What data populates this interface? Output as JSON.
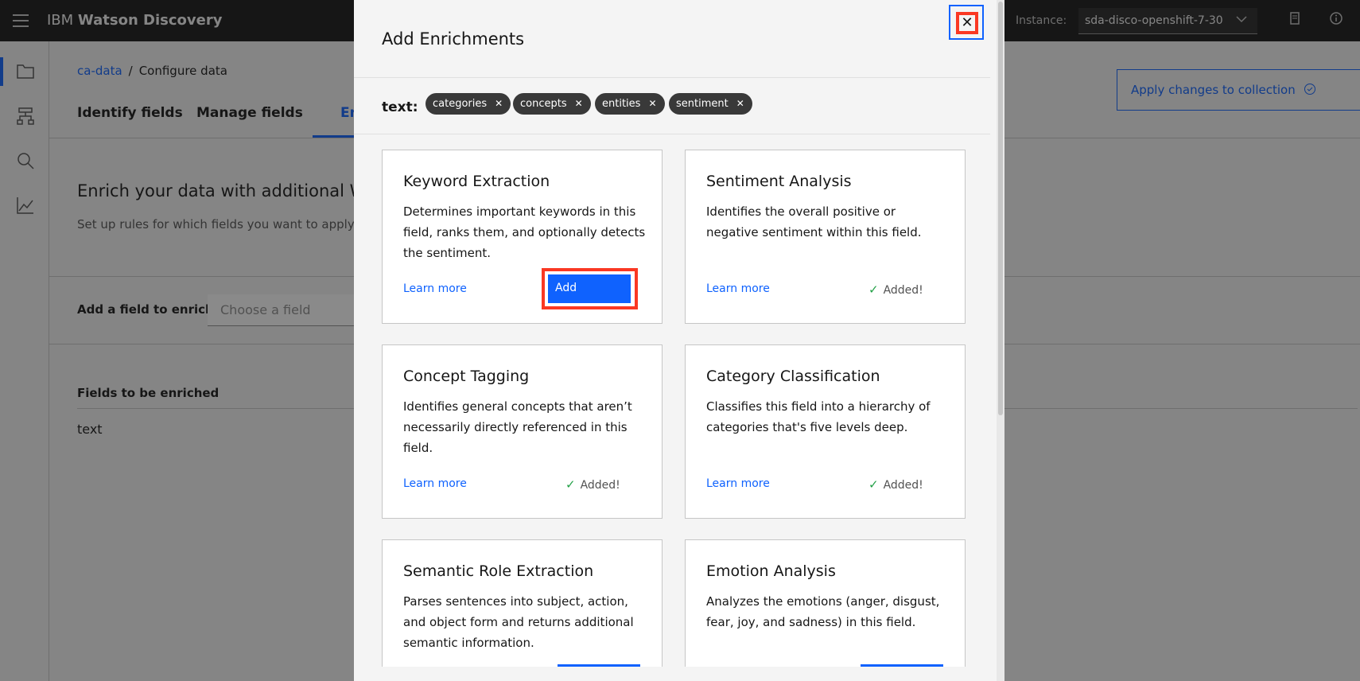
{
  "header": {
    "brand_prefix": "IBM",
    "brand_name": "Watson Discovery",
    "instance_label": "Instance:",
    "instance_value": "sda-disco-openshift-7-30"
  },
  "leftnav": {
    "items": [
      "folder-icon",
      "model-icon",
      "search-icon",
      "analytics-icon"
    ]
  },
  "page": {
    "breadcrumb": {
      "link": "ca-data",
      "separator": "/",
      "current": "Configure data"
    },
    "apply_button": "Apply changes to collection",
    "tabs": [
      "Identify fields",
      "Manage fields",
      "Enrich"
    ],
    "enrich_title": "Enrich your data with additional Watson",
    "enrich_subtitle": "Set up rules for which fields you want to apply enr",
    "add_field_label": "Add a field to enrich",
    "choose_field_placeholder": "Choose a field",
    "fields_heading": "Fields to be enriched",
    "fields": [
      "text"
    ]
  },
  "modal": {
    "title": "Add Enrichments",
    "close_label": "✕",
    "field_label": "text:",
    "tags": [
      "categories",
      "concepts",
      "entities",
      "sentiment"
    ],
    "cards": [
      {
        "title": "Keyword Extraction",
        "description": "Determines important keywords in this field, ranks them, and optionally detects the sentiment.",
        "learn_more": "Learn more",
        "action": "Add"
      },
      {
        "title": "Sentiment Analysis",
        "description": "Identifies the overall positive or negative sentiment within this field.",
        "learn_more": "Learn more",
        "status": "Added!"
      },
      {
        "title": "Concept Tagging",
        "description": "Identifies general concepts that aren’t necessarily directly referenced in this field.",
        "learn_more": "Learn more",
        "status": "Added!"
      },
      {
        "title": "Category Classification",
        "description": "Classifies this field into a hierarchy of categories that's five levels deep.",
        "learn_more": "Learn more",
        "status": "Added!"
      },
      {
        "title": "Semantic Role Extraction",
        "description": "Parses sentences into subject, action, and object form and returns additional semantic information."
      },
      {
        "title": "Emotion Analysis",
        "description": "Analyzes the emotions (anger, disgust, fear, joy, and sadness) in this field."
      }
    ]
  },
  "colors": {
    "accent": "#0f62fe",
    "highlight": "#fa3823",
    "success": "#24a148",
    "header_bg": "#161616"
  }
}
